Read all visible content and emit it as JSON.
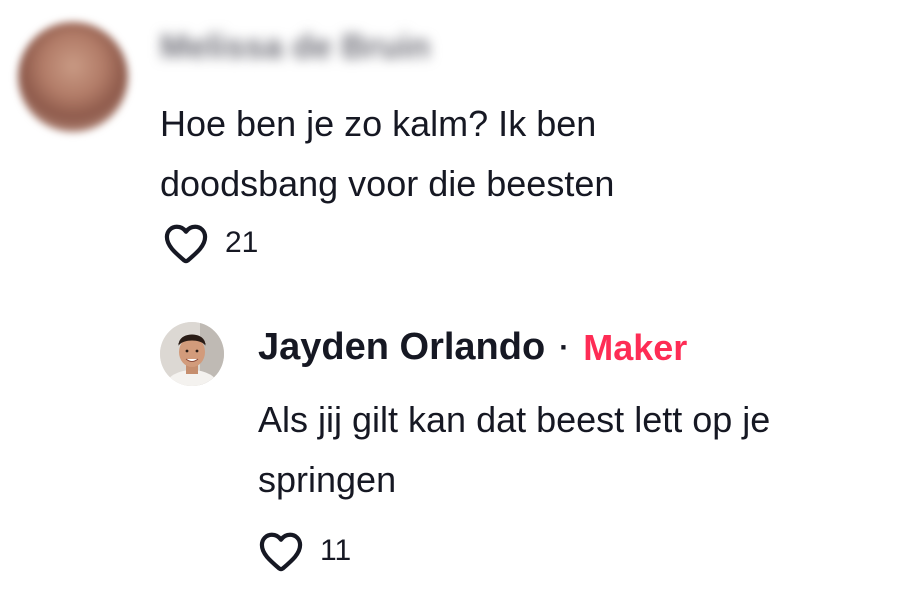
{
  "comments": [
    {
      "username": "Melissa de Bruin",
      "text": "Hoe ben je zo kalm? Ik ben doodsbang voor die beesten",
      "likes": "21",
      "like_icon": "heart-outline-icon"
    }
  ],
  "reply": {
    "username": "Jayden Orlando",
    "separator": "·",
    "badge": "Maker",
    "badge_color": "#fe2c55",
    "text": "Als jij gilt kan dat beest lett op je springen",
    "likes": "11",
    "like_icon": "heart-outline-icon"
  }
}
